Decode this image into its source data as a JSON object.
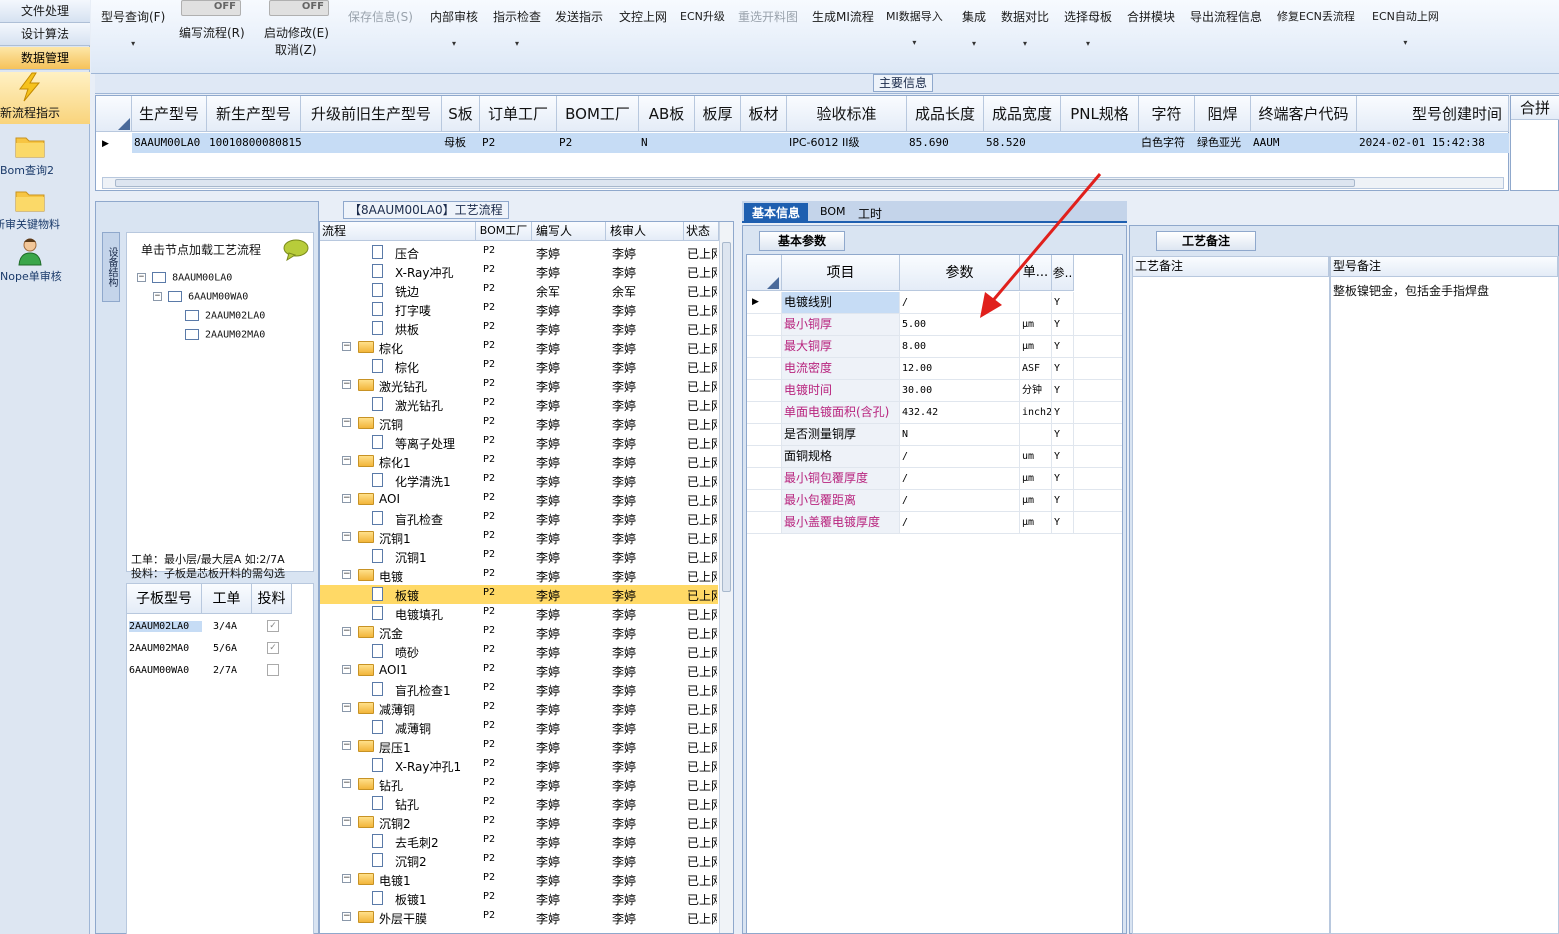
{
  "leftnav": {
    "tabs": [
      "文件处理",
      "设计算法",
      "数据管理"
    ],
    "items": [
      "新流程指示",
      "Bom查询2",
      "新审关键物料",
      "Nope单审核"
    ]
  },
  "toolbar": {
    "items": [
      "型号查询(F)",
      "编写流程(R)",
      "启动修改(E)",
      "取消(Z)",
      "保存信息(S)",
      "内部审核",
      "指示检查",
      "发送指示",
      "文控上网",
      "ECN升级",
      "重选开料图",
      "生成MI流程",
      "MI数据导入",
      "集成",
      "数据对比",
      "选择母板",
      "合拼模块",
      "导出流程信息",
      "修复ECN丢流程",
      "ECN自动上网"
    ],
    "toggle_text": "OFF"
  },
  "main": {
    "caption": "主要信息",
    "headers": [
      "生产型号",
      "新生产型号",
      "升级前旧生产型号",
      "S板",
      "订单工厂",
      "BOM工厂",
      "AB板",
      "板厚",
      "板材",
      "验收标准",
      "成品长度",
      "成品宽度",
      "PNL规格",
      "字符",
      "阻焊",
      "终端客户代码",
      "型号创建时间"
    ],
    "row": [
      "8AAUM00LA0",
      "10010800080815",
      "",
      "母板",
      "P2",
      "P2",
      "N",
      "",
      "",
      "IPC-6012 II级",
      "85.690",
      "58.520",
      "",
      "白色字符",
      "绿色亚光",
      "AAUM",
      "2024-02-01 15:42:38"
    ],
    "right_header": "合拼"
  },
  "left_panel": {
    "vertical_tab": "设备结构",
    "title": "单击节点加载工艺流程",
    "tree": [
      "8AAUM00LA0",
      "6AAUM00WA0",
      "2AAUM02LA0",
      "2AAUM02MA0"
    ],
    "note_line1": "工单：最小层/最大层A 如:2/7A",
    "note_line2": "投料：子板是芯板开料的需勾选",
    "sub_headers": [
      "子板型号",
      "工单",
      "投料"
    ],
    "sub_rows": [
      {
        "model": "2AAUM02LA0",
        "order": "3/4A"
      },
      {
        "model": "2AAUM02MA0",
        "order": "5/6A"
      },
      {
        "model": "6AAUM00WA0",
        "order": "2/7A"
      }
    ]
  },
  "flow": {
    "caption": "【8AAUM00LA0】工艺流程",
    "headers": [
      "流程",
      "BOM工厂",
      "编写人",
      "核审人",
      "状态"
    ],
    "rows": [
      {
        "name": "压合",
        "lvl": 1,
        "f": "P2",
        "w": "李婷",
        "r": "李婷",
        "s": "已上网"
      },
      {
        "name": "X-Ray冲孔",
        "lvl": 1,
        "f": "P2",
        "w": "李婷",
        "r": "李婷",
        "s": "已上网"
      },
      {
        "name": "铣边",
        "lvl": 1,
        "f": "P2",
        "w": "余军",
        "r": "余军",
        "s": "已上网"
      },
      {
        "name": "打字唛",
        "lvl": 1,
        "f": "P2",
        "w": "李婷",
        "r": "李婷",
        "s": "已上网"
      },
      {
        "name": "烘板",
        "lvl": 1,
        "f": "P2",
        "w": "李婷",
        "r": "李婷",
        "s": "已上网"
      },
      {
        "name": "棕化",
        "lvl": 0,
        "f": "P2",
        "w": "李婷",
        "r": "李婷",
        "s": "已上网"
      },
      {
        "name": "棕化",
        "lvl": 1,
        "f": "P2",
        "w": "李婷",
        "r": "李婷",
        "s": "已上网"
      },
      {
        "name": "激光钻孔",
        "lvl": 0,
        "f": "P2",
        "w": "李婷",
        "r": "李婷",
        "s": "已上网"
      },
      {
        "name": "激光钻孔",
        "lvl": 1,
        "f": "P2",
        "w": "李婷",
        "r": "李婷",
        "s": "已上网"
      },
      {
        "name": "沉铜",
        "lvl": 0,
        "f": "P2",
        "w": "李婷",
        "r": "李婷",
        "s": "已上网"
      },
      {
        "name": "等离子处理",
        "lvl": 1,
        "f": "P2",
        "w": "李婷",
        "r": "李婷",
        "s": "已上网"
      },
      {
        "name": "棕化1",
        "lvl": 0,
        "f": "P2",
        "w": "李婷",
        "r": "李婷",
        "s": "已上网"
      },
      {
        "name": "化学清洗1",
        "lvl": 1,
        "f": "P2",
        "w": "李婷",
        "r": "李婷",
        "s": "已上网"
      },
      {
        "name": "AOI",
        "lvl": 0,
        "f": "P2",
        "w": "李婷",
        "r": "李婷",
        "s": "已上网"
      },
      {
        "name": "盲孔检查",
        "lvl": 1,
        "f": "P2",
        "w": "李婷",
        "r": "李婷",
        "s": "已上网"
      },
      {
        "name": "沉铜1",
        "lvl": 0,
        "f": "P2",
        "w": "李婷",
        "r": "李婷",
        "s": "已上网"
      },
      {
        "name": "沉铜1",
        "lvl": 1,
        "f": "P2",
        "w": "李婷",
        "r": "李婷",
        "s": "已上网"
      },
      {
        "name": "电镀",
        "lvl": 0,
        "f": "P2",
        "w": "李婷",
        "r": "李婷",
        "s": "已上网"
      },
      {
        "name": "板镀",
        "lvl": 1,
        "f": "P2",
        "w": "李婷",
        "r": "李婷",
        "s": "已上网",
        "sel": true
      },
      {
        "name": "电镀填孔",
        "lvl": 1,
        "f": "P2",
        "w": "李婷",
        "r": "李婷",
        "s": "已上网"
      },
      {
        "name": "沉金",
        "lvl": 0,
        "f": "P2",
        "w": "李婷",
        "r": "李婷",
        "s": "已上网"
      },
      {
        "name": "喷砂",
        "lvl": 1,
        "f": "P2",
        "w": "李婷",
        "r": "李婷",
        "s": "已上网"
      },
      {
        "name": "AOI1",
        "lvl": 0,
        "f": "P2",
        "w": "李婷",
        "r": "李婷",
        "s": "已上网"
      },
      {
        "name": "盲孔检查1",
        "lvl": 1,
        "f": "P2",
        "w": "李婷",
        "r": "李婷",
        "s": "已上网"
      },
      {
        "name": "减薄铜",
        "lvl": 0,
        "f": "P2",
        "w": "李婷",
        "r": "李婷",
        "s": "已上网"
      },
      {
        "name": "减薄铜",
        "lvl": 1,
        "f": "P2",
        "w": "李婷",
        "r": "李婷",
        "s": "已上网"
      },
      {
        "name": "层压1",
        "lvl": 0,
        "f": "P2",
        "w": "李婷",
        "r": "李婷",
        "s": "已上网"
      },
      {
        "name": "X-Ray冲孔1",
        "lvl": 1,
        "f": "P2",
        "w": "李婷",
        "r": "李婷",
        "s": "已上网"
      },
      {
        "name": "钻孔",
        "lvl": 0,
        "f": "P2",
        "w": "李婷",
        "r": "李婷",
        "s": "已上网"
      },
      {
        "name": "钻孔",
        "lvl": 1,
        "f": "P2",
        "w": "李婷",
        "r": "李婷",
        "s": "已上网"
      },
      {
        "name": "沉铜2",
        "lvl": 0,
        "f": "P2",
        "w": "李婷",
        "r": "李婷",
        "s": "已上网"
      },
      {
        "name": "去毛刺2",
        "lvl": 1,
        "f": "P2",
        "w": "李婷",
        "r": "李婷",
        "s": "已上网"
      },
      {
        "name": "沉铜2",
        "lvl": 1,
        "f": "P2",
        "w": "李婷",
        "r": "李婷",
        "s": "已上网"
      },
      {
        "name": "电镀1",
        "lvl": 0,
        "f": "P2",
        "w": "李婷",
        "r": "李婷",
        "s": "已上网"
      },
      {
        "name": "板镀1",
        "lvl": 1,
        "f": "P2",
        "w": "李婷",
        "r": "李婷",
        "s": "已上网"
      },
      {
        "name": "外层干膜",
        "lvl": 0,
        "f": "P2",
        "w": "李婷",
        "r": "李婷",
        "s": "已上网"
      }
    ]
  },
  "detail": {
    "tabs": [
      "基本信息",
      "BOM",
      "工时"
    ],
    "subtab": "基本参数",
    "headers": [
      "项目",
      "参数",
      "单...",
      "参.."
    ],
    "rows": [
      {
        "item": "电镀线别",
        "val": "/",
        "unit": "",
        "flag": "Y",
        "pink": false
      },
      {
        "item": "最小铜厚",
        "val": "5.00",
        "unit": "μm",
        "flag": "Y",
        "pink": true
      },
      {
        "item": "最大铜厚",
        "val": "8.00",
        "unit": "μm",
        "flag": "Y",
        "pink": true
      },
      {
        "item": "电流密度",
        "val": "12.00",
        "unit": "ASF",
        "flag": "Y",
        "pink": true
      },
      {
        "item": "电镀时间",
        "val": "30.00",
        "unit": "分钟",
        "flag": "Y",
        "pink": true
      },
      {
        "item": "单面电镀面积(含孔)",
        "val": "432.42",
        "unit": "inch2",
        "flag": "Y",
        "pink": true
      },
      {
        "item": "是否测量铜厚",
        "val": "N",
        "unit": "",
        "flag": "Y",
        "pink": false
      },
      {
        "item": "面铜规格",
        "val": "/",
        "unit": "um",
        "flag": "Y",
        "pink": false
      },
      {
        "item": "最小铜包覆厚度",
        "val": "/",
        "unit": "μm",
        "flag": "Y",
        "pink": true
      },
      {
        "item": "最小包覆距离",
        "val": "/",
        "unit": "μm",
        "flag": "Y",
        "pink": true
      },
      {
        "item": "最小盖覆电镀厚度",
        "val": "/",
        "unit": "μm",
        "flag": "Y",
        "pink": true
      }
    ]
  },
  "remarks": {
    "tab": "工艺备注",
    "h1": "工艺备注",
    "h2": "型号备注",
    "model_note": "整板镍钯金，包括金手指焊盘"
  },
  "colors": {
    "accent": "#1e5fb0",
    "selection": "#c6dcf5",
    "highlight": "#ffd966",
    "pink": "#b8247e",
    "arrow": "#e0201c"
  }
}
